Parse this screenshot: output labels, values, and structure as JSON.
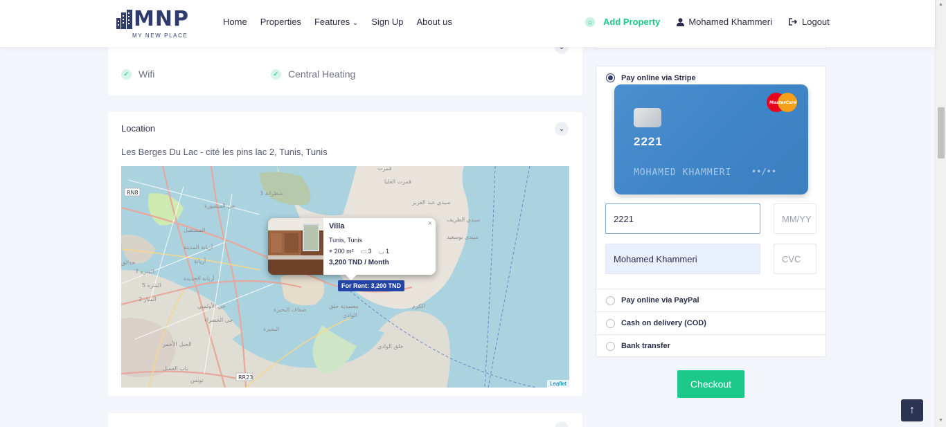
{
  "brand": {
    "letters": "MNP",
    "tagline": "MY NEW PLACE"
  },
  "nav": {
    "items": [
      "Home",
      "Properties",
      "Features",
      "Sign Up",
      "About us"
    ],
    "features_chevron": "⌄",
    "add_property": "Add Property",
    "user_name": "Mohamed Khammeri",
    "logout": "Logout"
  },
  "amenities": {
    "items": [
      "Wifi",
      "Central Heating"
    ]
  },
  "location": {
    "title": "Location",
    "address": "Les Berges Du Lac - cité les pins lac 2, Tunis, Tunis"
  },
  "map": {
    "popup": {
      "title": "Villa",
      "location": "Tunis, Tunis",
      "area": "200 m²",
      "bedrooms": "3",
      "bathrooms": "1",
      "price": "3,200 TND / Month",
      "close": "×"
    },
    "marker_label": "For Rent: 3,200 TND",
    "attribution": "Leaflet",
    "road_labels": [
      "RN8",
      "RR23"
    ]
  },
  "payment": {
    "options": [
      {
        "label": "Pay online via Stripe",
        "selected": true
      },
      {
        "label": "Pay online via PayPal",
        "selected": false
      },
      {
        "label": "Cash on delivery (COD)",
        "selected": false
      },
      {
        "label": "Bank transfer",
        "selected": false
      }
    ],
    "card_preview": {
      "number": "2221",
      "name": "MOHAMED KHAMMERI",
      "expiry": "••/••",
      "brand_text": "MasterCard"
    },
    "fields": {
      "number_value": "2221",
      "expiry_placeholder": "MM/YY",
      "name_value": "Mohamed Khammeri",
      "cvc_placeholder": "CVC"
    },
    "checkout_label": "Checkout"
  },
  "colors": {
    "accent": "#1cc88a",
    "brand": "#2f3a6d",
    "marker": "#2545a6",
    "card": "#4189cc"
  }
}
